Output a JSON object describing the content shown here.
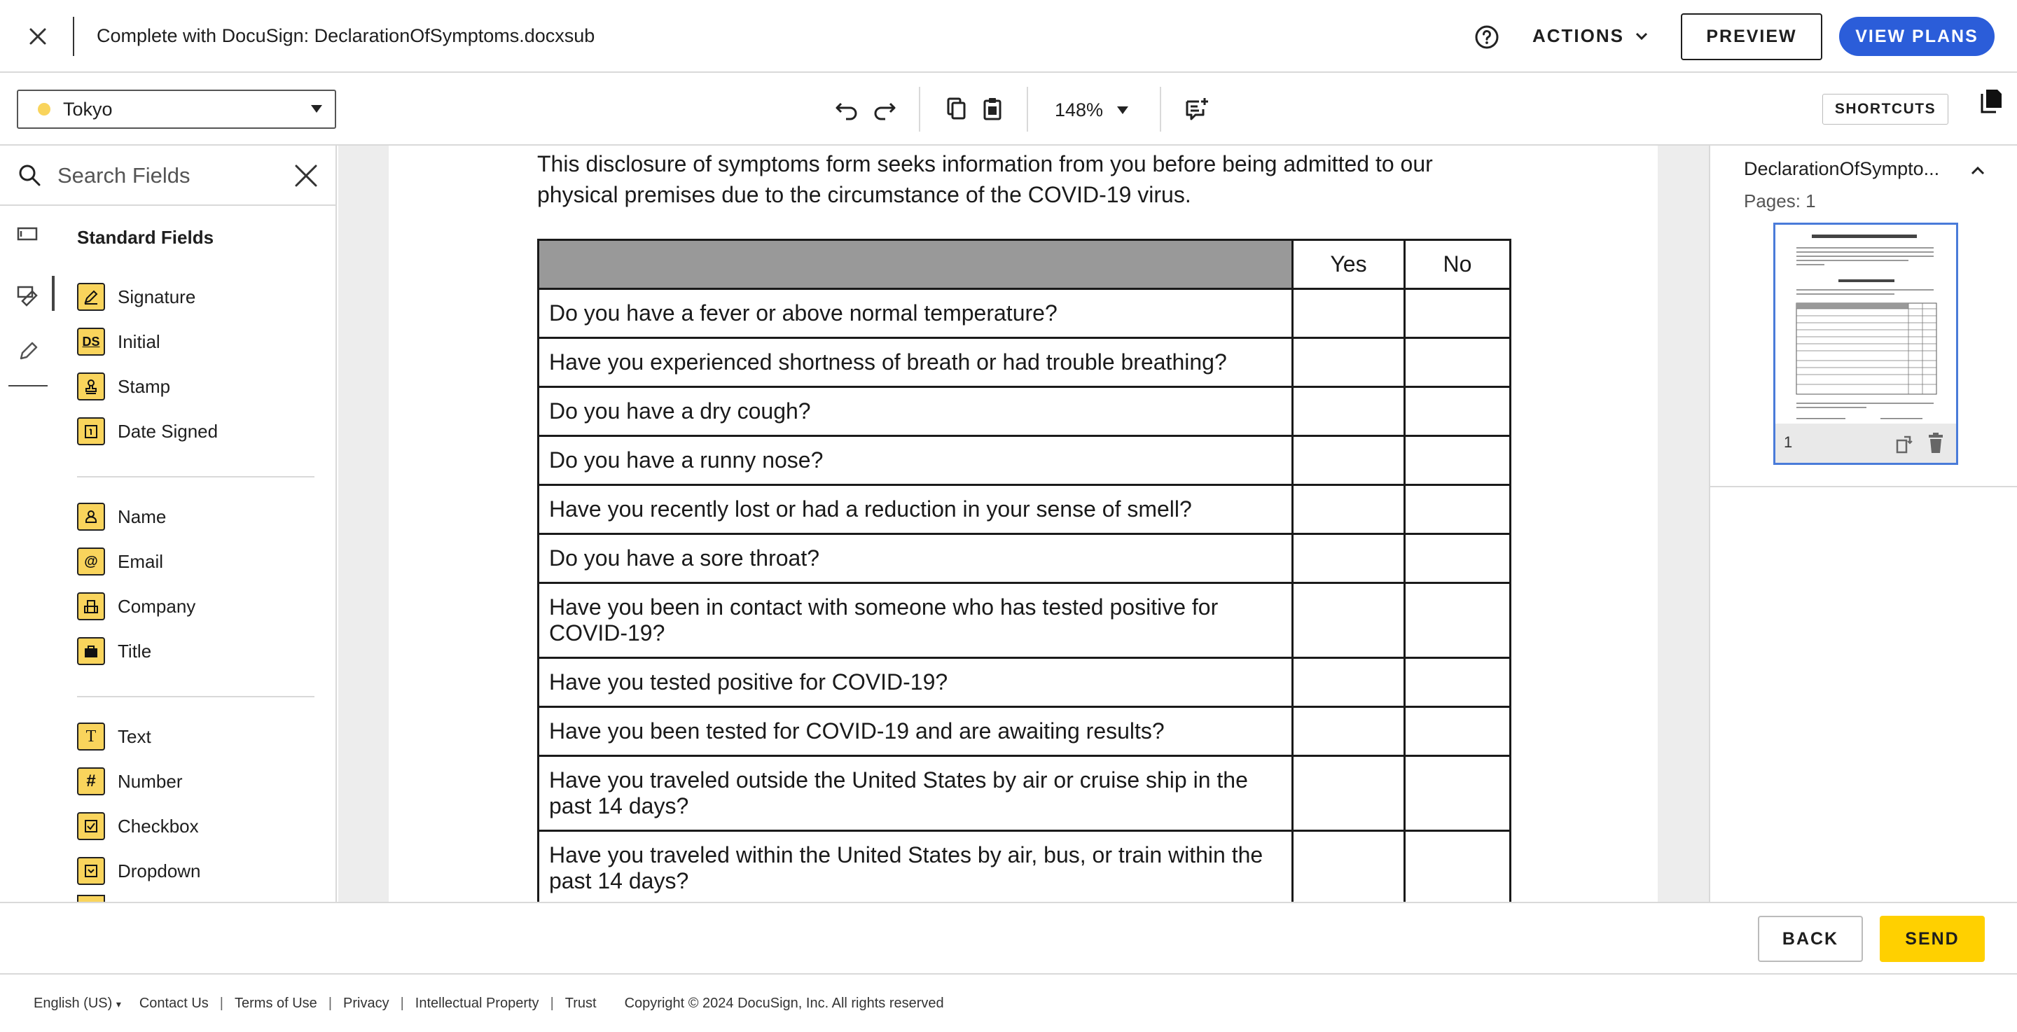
{
  "header": {
    "title": "Complete with DocuSign: DeclarationOfSymptoms.docxsub",
    "actions_label": "ACTIONS",
    "preview_label": "PREVIEW",
    "view_plans_label": "VIEW PLANS",
    "brand_color": "#2b5dd9"
  },
  "toolbar": {
    "recipient": "Tokyo",
    "recipient_color": "#f9d45c",
    "zoom": "148%",
    "shortcuts_label": "SHORTCUTS"
  },
  "sidebar": {
    "search_placeholder": "Search Fields",
    "heading": "Standard Fields",
    "fields": [
      {
        "label": "Signature",
        "icon": "pen-icon"
      },
      {
        "label": "Initial",
        "icon": "ds-icon",
        "glyph": "DS"
      },
      {
        "label": "Stamp",
        "icon": "stamp-icon"
      },
      {
        "label": "Date Signed",
        "icon": "calendar-icon"
      },
      {
        "label": "Name",
        "icon": "person-icon"
      },
      {
        "label": "Email",
        "icon": "at-icon",
        "glyph": "@"
      },
      {
        "label": "Company",
        "icon": "building-icon"
      },
      {
        "label": "Title",
        "icon": "briefcase-icon"
      },
      {
        "label": "Text",
        "icon": "text-icon",
        "glyph": "T"
      },
      {
        "label": "Number",
        "icon": "hash-icon",
        "glyph": "#"
      },
      {
        "label": "Checkbox",
        "icon": "checkbox-icon"
      },
      {
        "label": "Dropdown",
        "icon": "dropdown-icon"
      }
    ]
  },
  "document": {
    "intro": "This disclosure of symptoms form seeks information from you before being admitted to our physical premises due to the circumstance of the COVID-19 virus.",
    "columns": [
      "Yes",
      "No"
    ],
    "questions": [
      "Do you have a fever or above normal temperature?",
      "Have you experienced shortness of breath or had trouble breathing?",
      "Do you have a dry cough?",
      "Do you have a runny nose?",
      "Have you recently lost or had a reduction in your sense of smell?",
      "Do you have a sore throat?",
      "Have you been in contact with someone who has tested positive for COVID-19?",
      "Have you tested positive for COVID-19?",
      "Have you been tested for COVID-19 and are awaiting results?",
      "Have you traveled outside the United States by air or cruise ship in the past 14 days?",
      "Have you traveled within the United States by air, bus, or train within the past 14 days?"
    ]
  },
  "right_panel": {
    "doc_name": "DeclarationOfSympto...",
    "pages": "Pages: 1",
    "thumb_page_num": "1"
  },
  "bottom": {
    "back_label": "BACK",
    "send_label": "SEND",
    "send_color": "#ffd000"
  },
  "footer": {
    "language": "English (US)",
    "links": [
      "Contact Us",
      "Terms of Use",
      "Privacy",
      "Intellectual Property",
      "Trust"
    ],
    "copyright": "Copyright © 2024 DocuSign, Inc. All rights reserved"
  }
}
